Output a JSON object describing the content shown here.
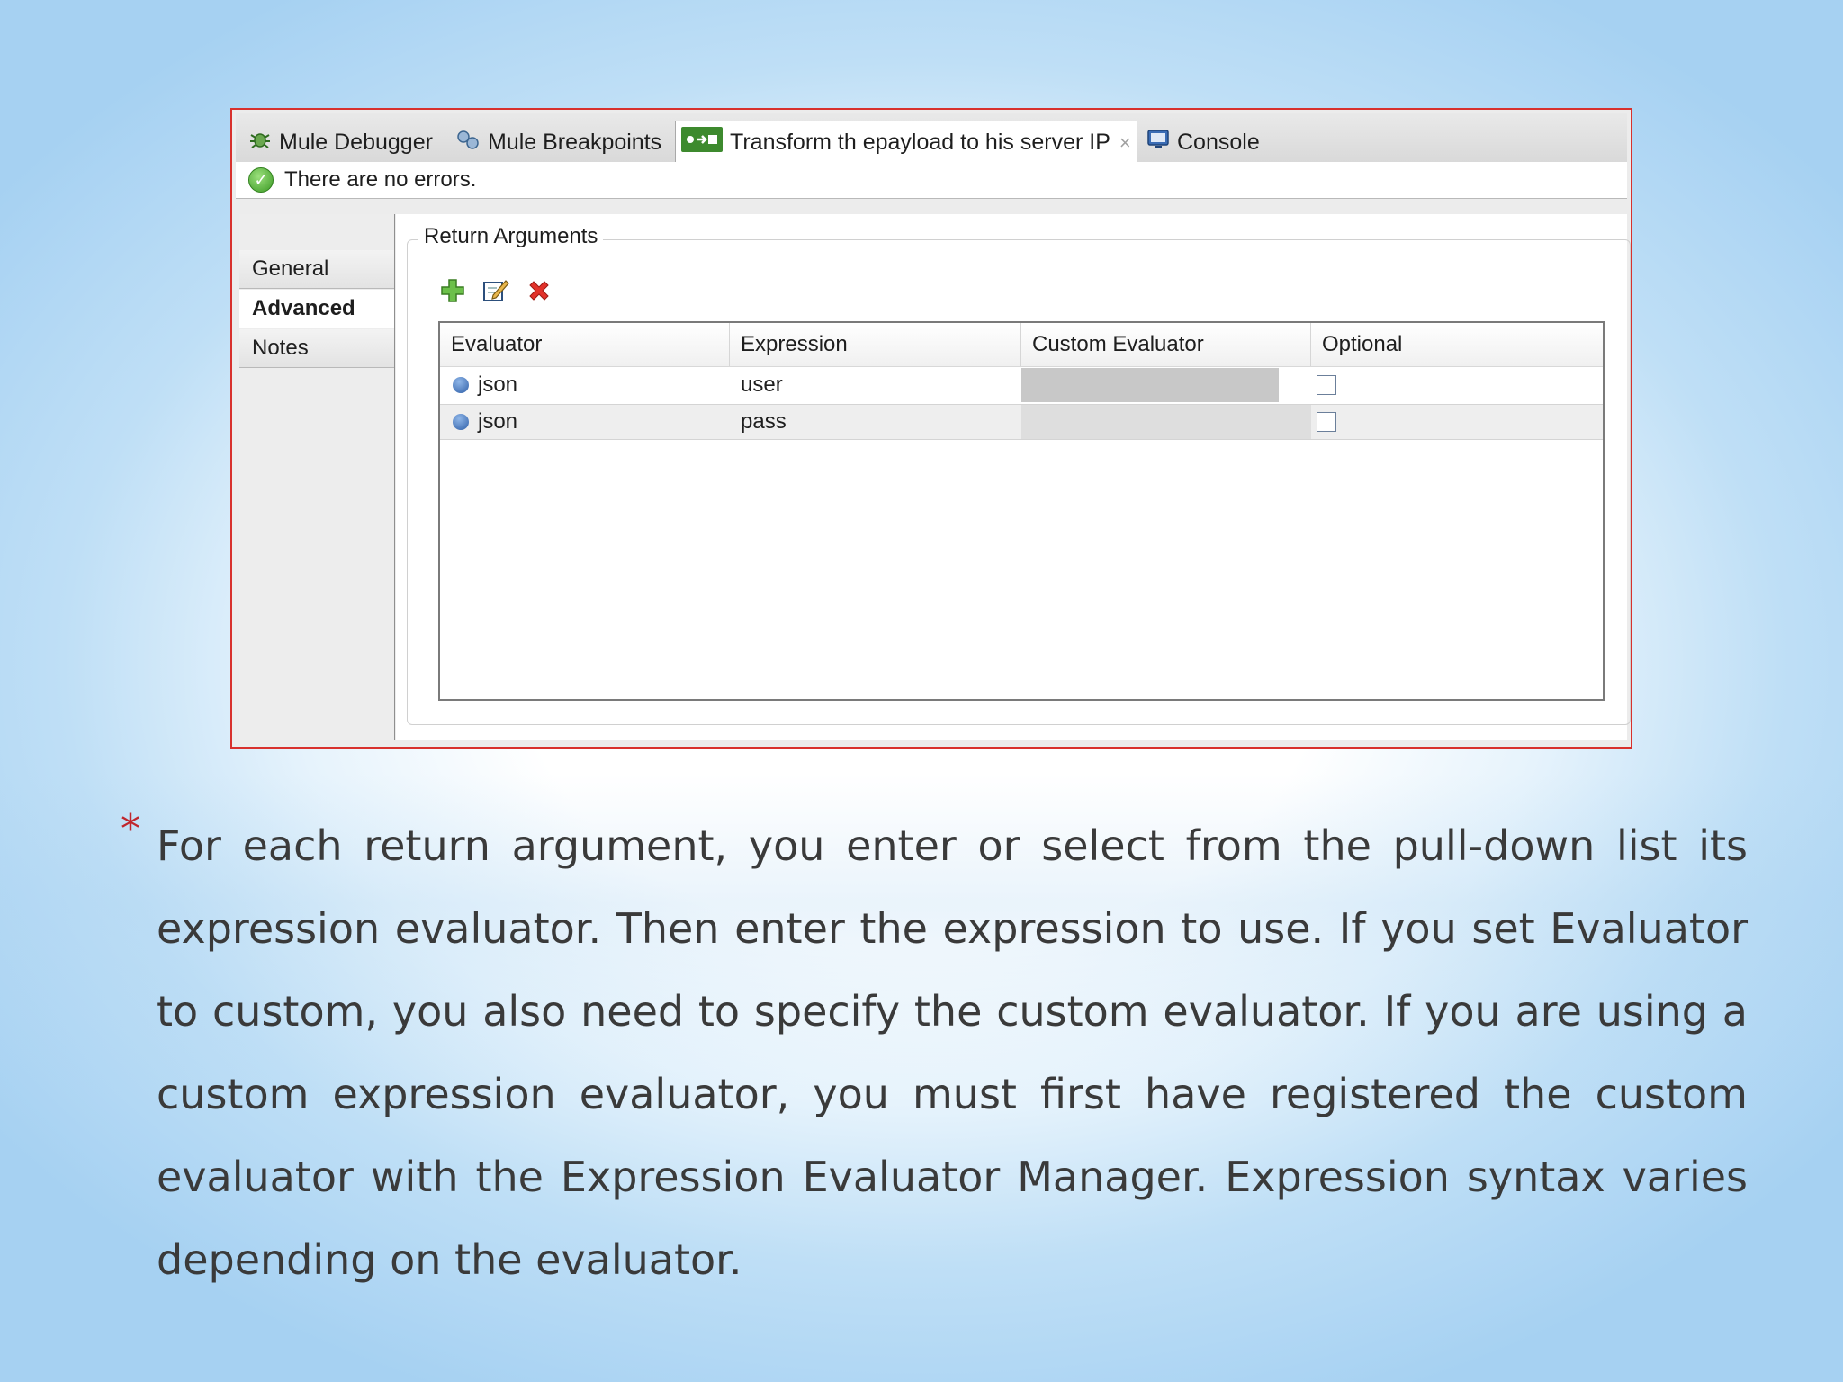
{
  "tabs": [
    {
      "label": "Mule Debugger",
      "icon": "bug-icon"
    },
    {
      "label": "Mule Breakpoints",
      "icon": "breakpoints-icon"
    },
    {
      "label": "Transform th epayload to his server IP",
      "icon": "transformer-icon",
      "active": true,
      "close": "×"
    },
    {
      "label": "Console",
      "icon": "console-icon"
    }
  ],
  "status": {
    "message": "There are no errors.",
    "icon": "check-icon"
  },
  "sidebar": {
    "items": [
      {
        "label": "General"
      },
      {
        "label": "Advanced",
        "selected": true
      },
      {
        "label": "Notes"
      }
    ]
  },
  "group": {
    "title": "Return Arguments"
  },
  "toolbar": {
    "add": "add-icon",
    "edit": "edit-icon",
    "delete": "delete-icon"
  },
  "table": {
    "headers": [
      "Evaluator",
      "Expression",
      "Custom Evaluator",
      "Optional"
    ],
    "rows": [
      {
        "evaluator": "json",
        "expression": "user",
        "custom_evaluator": "",
        "optional": false
      },
      {
        "evaluator": "json",
        "expression": "pass",
        "custom_evaluator": "",
        "optional": false
      }
    ]
  },
  "caption": {
    "bullet": "*",
    "text": "For each return argument, you enter or select from the pull-down list its expression evaluator. Then enter the expression to use. If you set Evaluator to custom, you also need to specify the custom evaluator. If you are using a custom expression evaluator, you must first have registered the custom evaluator with the Expression Evaluator Manager. Expression syntax varies depending on the evaluator."
  },
  "colors": {
    "frame_border": "#d8312d",
    "bullet": "#c0262d",
    "text": "#3a3a3a"
  }
}
